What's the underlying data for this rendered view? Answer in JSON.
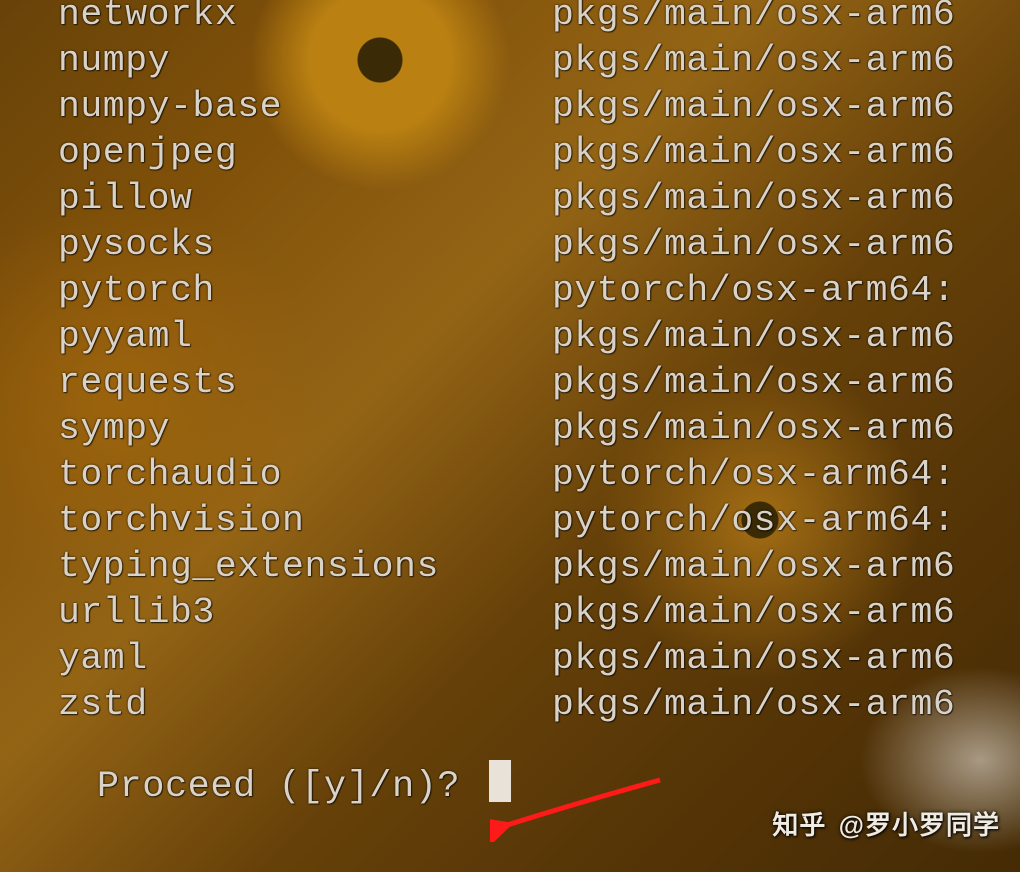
{
  "packages": [
    {
      "name": "networkx",
      "source": "pkgs/main/osx-arm6"
    },
    {
      "name": "numpy",
      "source": "pkgs/main/osx-arm6"
    },
    {
      "name": "numpy-base",
      "source": "pkgs/main/osx-arm6"
    },
    {
      "name": "openjpeg",
      "source": "pkgs/main/osx-arm6"
    },
    {
      "name": "pillow",
      "source": "pkgs/main/osx-arm6"
    },
    {
      "name": "pysocks",
      "source": "pkgs/main/osx-arm6"
    },
    {
      "name": "pytorch",
      "source": "pytorch/osx-arm64:"
    },
    {
      "name": "pyyaml",
      "source": "pkgs/main/osx-arm6"
    },
    {
      "name": "requests",
      "source": "pkgs/main/osx-arm6"
    },
    {
      "name": "sympy",
      "source": "pkgs/main/osx-arm6"
    },
    {
      "name": "torchaudio",
      "source": "pytorch/osx-arm64:"
    },
    {
      "name": "torchvision",
      "source": "pytorch/osx-arm64:"
    },
    {
      "name": "typing_extensions",
      "source": "pkgs/main/osx-arm6"
    },
    {
      "name": "urllib3",
      "source": "pkgs/main/osx-arm6"
    },
    {
      "name": "yaml",
      "source": "pkgs/main/osx-arm6"
    },
    {
      "name": "zstd",
      "source": "pkgs/main/osx-arm6"
    }
  ],
  "prompt": "Proceed ([y]/n)? ",
  "watermark": {
    "site": "知乎",
    "handle": "@罗小罗同学"
  }
}
